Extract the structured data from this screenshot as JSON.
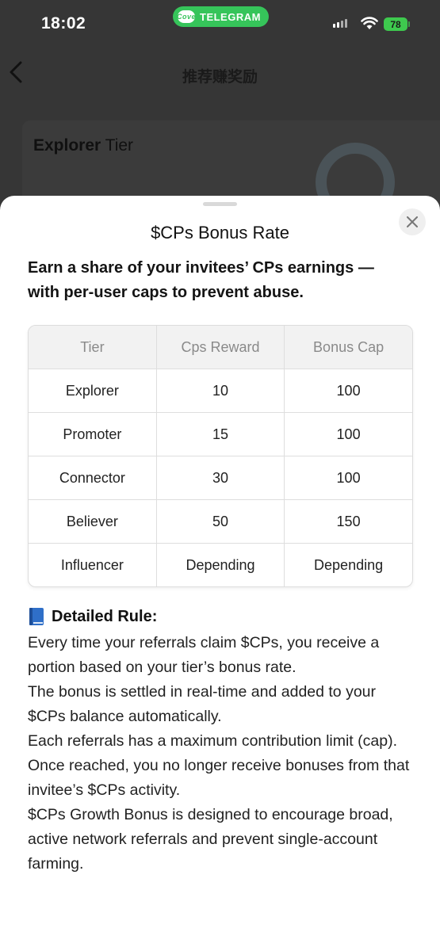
{
  "status_bar": {
    "time": "18:02",
    "app_pill_label": "TELEGRAM",
    "app_logo_text": "Cove",
    "battery": "78"
  },
  "nav": {
    "title": "推荐赚奖励"
  },
  "tier_card": {
    "tier_name": "Explorer",
    "tier_word": " Tier"
  },
  "sheet": {
    "title": "$CPs Bonus Rate",
    "subtitle": "Earn a share of your invitees’ CPs earnings — with per-user caps to prevent abuse.",
    "table": {
      "headers": [
        "Tier",
        "Cps Reward",
        "Bonus Cap"
      ],
      "rows": [
        [
          "Explorer",
          "10",
          "100"
        ],
        [
          "Promoter",
          "15",
          "100"
        ],
        [
          "Connector",
          "30",
          "100"
        ],
        [
          "Believer",
          "50",
          "150"
        ],
        [
          "Influencer",
          "Depending",
          "Depending"
        ]
      ]
    },
    "rules_title": "Detailed Rule:",
    "rules": [
      "Every time your referrals claim $CPs, you receive a portion based on your tier’s bonus rate.",
      "The bonus is settled in real-time and added to your $CPs balance automatically.",
      "Each referrals has a maximum contribution limit (cap). Once reached, you no longer receive bonuses from that invitee’s $CPs activity.",
      "$CPs Growth Bonus is designed to encourage broad, active network referrals and prevent single-account farming."
    ]
  },
  "icons": {
    "back": "chevron-left-icon",
    "close": "close-icon",
    "rules": "blue-book-icon",
    "wifi": "wifi-icon",
    "signal": "cellular-signal-icon"
  },
  "colors": {
    "telegram_pill": "#36c45a",
    "battery": "#3ec94e",
    "sheet_bg": "#ffffff",
    "overlay": "#363636",
    "table_header_bg": "#f2f2f2",
    "book_blue": "#2f6fc8"
  }
}
